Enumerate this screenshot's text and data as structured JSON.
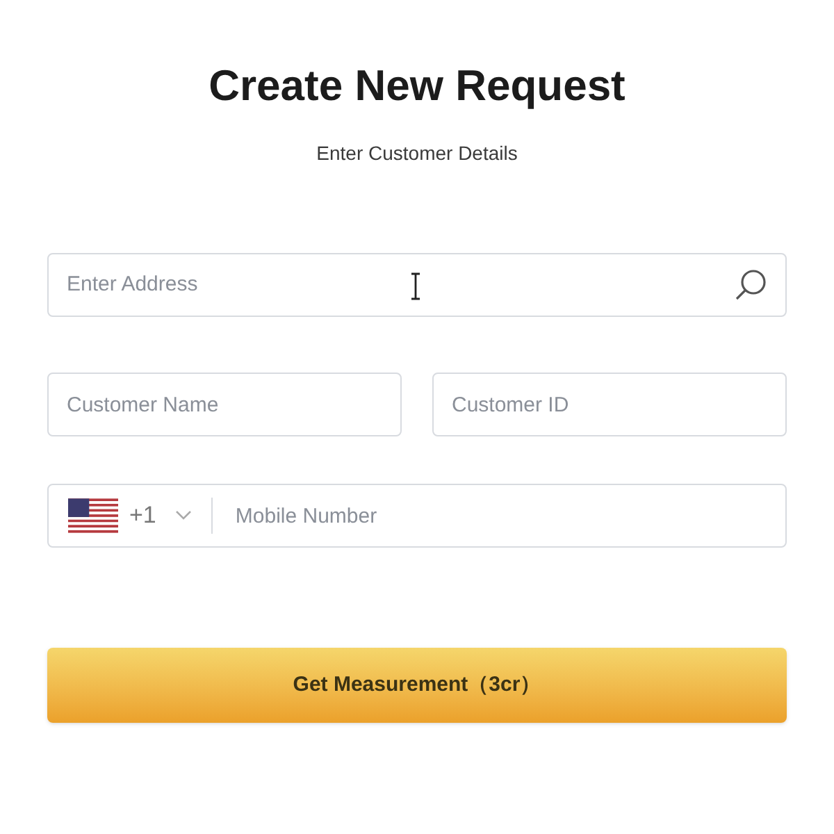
{
  "title": "Create New Request",
  "subtitle": "Enter Customer Details",
  "address_field": {
    "placeholder": "Enter Address"
  },
  "name_field": {
    "placeholder": "Customer Name"
  },
  "id_field": {
    "placeholder": "Customer ID"
  },
  "phone": {
    "country_code": "+1",
    "placeholder": "Mobile Number"
  },
  "submit_button": "Get Measurement（3cr）"
}
